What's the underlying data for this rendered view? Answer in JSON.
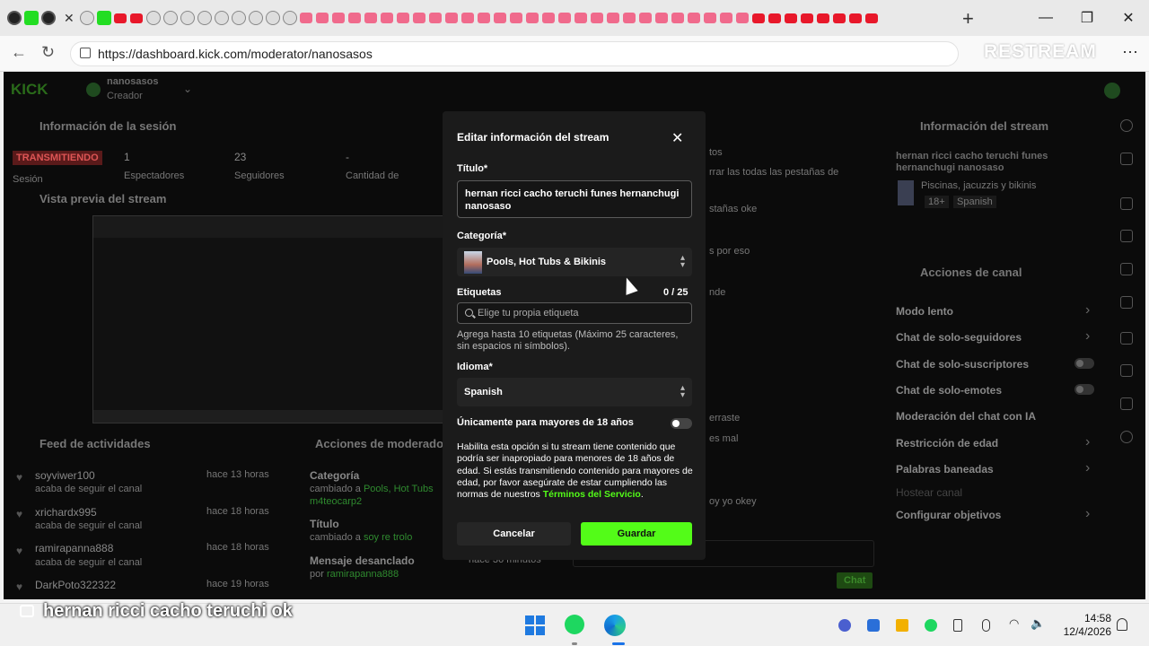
{
  "browser": {
    "url": "https://dashboard.kick.com/moderator/nanosasos",
    "watermark": "RESTREAM"
  },
  "dashboard": {
    "logo": "KICK",
    "user": {
      "name": "nanosasos",
      "role": "Creador"
    },
    "session": {
      "title": "Información de la sesión",
      "live_badge": "TRANSMITIENDO",
      "session_label": "Sesión",
      "stats": [
        {
          "value": "1",
          "label": "Espectadores"
        },
        {
          "value": "23",
          "label": "Seguidores"
        },
        {
          "value": "-",
          "label": "Cantidad de"
        }
      ]
    },
    "preview_title": "Vista previa del stream",
    "activity_feed": {
      "title": "Feed de actividades",
      "items": [
        {
          "user": "soyviwer100",
          "time": "hace 13 horas",
          "text": "acaba de seguir el canal"
        },
        {
          "user": "xrichardx995",
          "time": "hace 18 horas",
          "text": "acaba de seguir el canal"
        },
        {
          "user": "ramirapanna888",
          "time": "hace 18 horas",
          "text": "acaba de seguir el canal"
        },
        {
          "user": "DarkPoto322322",
          "time": "hace 19 horas",
          "text": ""
        }
      ]
    },
    "mod_actions": {
      "title": "Acciones de moderador",
      "items": [
        {
          "title": "Categoría",
          "line1": "cambiado a ",
          "hl1": "Pools, Hot Tubs",
          "line2": "m4teocarp2"
        },
        {
          "title": "Título",
          "line1": "cambiado a ",
          "hl1": "soy re trolo",
          "line2": ""
        },
        {
          "title": "Mensaje desanclado",
          "line1": "por ",
          "hl1": "ramirapanna888",
          "line2": "",
          "time": "hace 36 minutos"
        }
      ]
    },
    "chat_fragments": [
      "tos",
      "rrar las todas las pestañas de",
      "stañas oke",
      "s por eso",
      "nde",
      "erraste",
      "es mal",
      "oy yo okey"
    ],
    "chat_button": "Chat",
    "stream_info": {
      "title": "Información del stream",
      "stream_title": "hernan ricci cacho teruchi funes hernanchugi nanosaso",
      "category": "Piscinas, jacuzzis y bikinis",
      "tags": [
        "18+",
        "Spanish"
      ]
    },
    "channel_actions": {
      "title": "Acciones de canal",
      "items": [
        "Modo lento",
        "Chat de solo-seguidores",
        "Chat de solo-suscriptores",
        "Chat de solo-emotes",
        "Moderación del chat con IA",
        "Restricción de edad",
        "Palabras baneadas",
        "Hostear canal",
        "Configurar objetivos"
      ]
    }
  },
  "modal": {
    "title": "Editar información del stream",
    "title_label": "Título*",
    "title_value": "hernan ricci cacho teruchi funes hernanchugi nanosaso",
    "category_label": "Categoría*",
    "category_value": "Pools, Hot Tubs & Bikinis",
    "tags_label": "Etiquetas",
    "tags_count": "0 / 25",
    "tags_placeholder": "Elige tu propia etiqueta",
    "tags_help": "Agrega hasta 10 etiquetas (Máximo 25 caracteres, sin espacios ni símbolos).",
    "language_label": "Idioma*",
    "language_value": "Spanish",
    "adult_label": "Únicamente para mayores de 18 años",
    "adult_enabled": false,
    "adult_desc": "Habilita esta opción si tu stream tiene contenido que podría ser inapropiado para menores de 18 años de edad. Si estás transmitiendo contenido para mayores de edad, por favor asegúrate de estar cumpliendo las normas de nuestros ",
    "terms_link": "Términos del Servicio",
    "terms_end": ".",
    "cancel": "Cancelar",
    "save": "Guardar",
    "accent": "#53fc18"
  },
  "caption": "hernan ricci cacho teruchi ok",
  "taskbar": {
    "time": "14:58",
    "date": "12/4/2026"
  }
}
